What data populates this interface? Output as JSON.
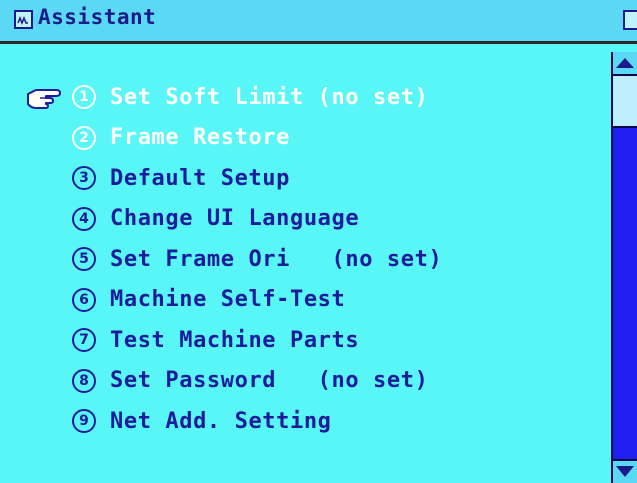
{
  "window": {
    "title": "Assistant",
    "title_icon": "chart-window-icon",
    "right_icon": "document-icon"
  },
  "colors": {
    "background": "#58f6f6",
    "titlebar": "#5bd9f4",
    "selected_text": "#ffffff",
    "item_text": "#1c1c9c",
    "scrollbar_track": "#1f1ff0"
  },
  "menu": {
    "pointer_icon": "pointing-hand-icon",
    "selected_index": 0,
    "items": [
      {
        "num": "1",
        "label": "Set Soft Limit (no set)"
      },
      {
        "num": "2",
        "label": "Frame Restore"
      },
      {
        "num": "3",
        "label": "Default Setup"
      },
      {
        "num": "4",
        "label": "Change UI Language"
      },
      {
        "num": "5",
        "label": "Set Frame Ori   (no set)"
      },
      {
        "num": "6",
        "label": "Machine Self-Test"
      },
      {
        "num": "7",
        "label": "Test Machine Parts"
      },
      {
        "num": "8",
        "label": "Set Password   (no set)"
      },
      {
        "num": "9",
        "label": "Net Add. Setting"
      }
    ]
  }
}
